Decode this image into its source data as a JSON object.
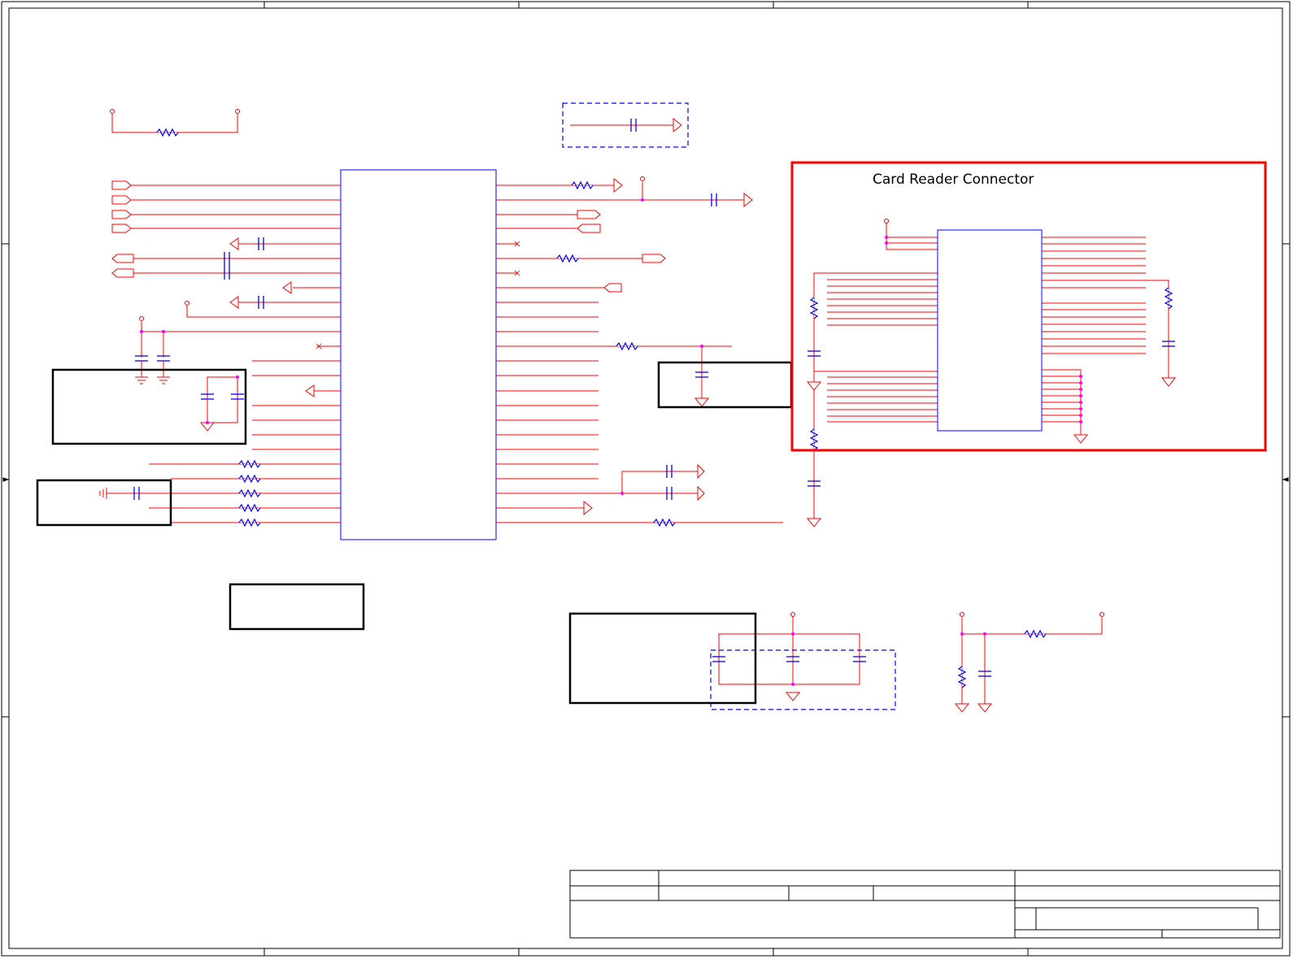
{
  "sheet": {
    "title": "Card Reader Connector"
  },
  "colors": {
    "net": "#ff0000",
    "component": "#0000ff",
    "junction": "#ff00ff",
    "highlight_box": "#ff0000",
    "frame": "#000000",
    "optional_box": "#0000ff"
  },
  "icons": {
    "power": "open-circle-power-symbol",
    "ground": "ground-arrow-symbol",
    "chassis_ground": "chassis-ground-symbol",
    "off_page_port": "pentagon-port-symbol",
    "no_connect": "x-no-connect-marker",
    "resistor": "zigzag-resistor-symbol",
    "capacitor": "parallel-plate-capacitor-symbol"
  }
}
